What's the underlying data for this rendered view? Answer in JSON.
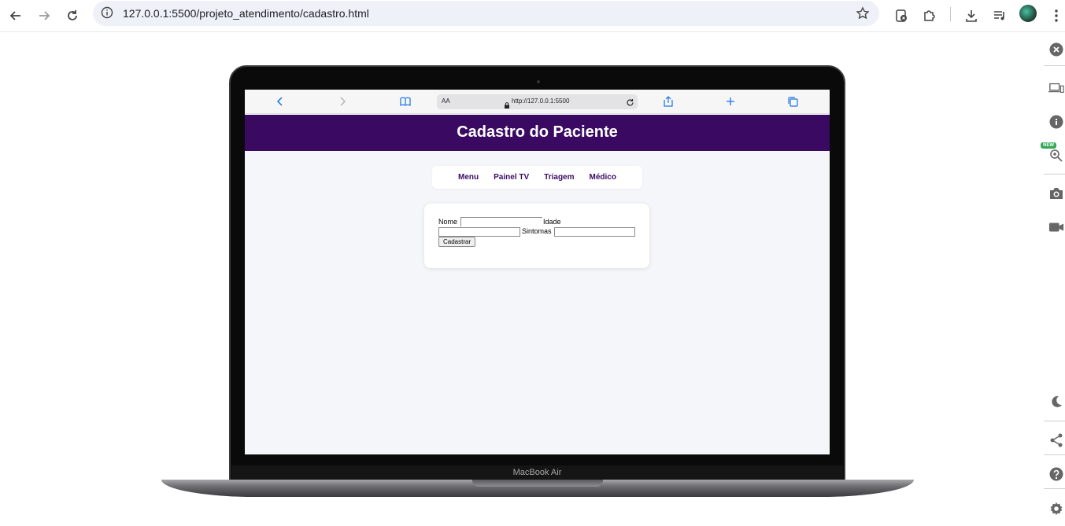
{
  "browser": {
    "url": "127.0.0.1:5500/projeto_atendimento/cadastro.html",
    "icons": [
      "back-icon",
      "forward-icon",
      "reload-icon",
      "site-info-icon",
      "bookmark-star-icon",
      "extension-icon",
      "puzzle-icon",
      "download-icon",
      "media-icon",
      "profile-avatar",
      "more-menu-icon"
    ]
  },
  "side_panel": {
    "new_badge": "NEW",
    "icons": [
      "close-icon",
      "devices-icon",
      "info-icon",
      "zoom-icon",
      "camera-icon",
      "video-icon",
      "dark-mode-icon",
      "share-icon",
      "help-icon",
      "settings-icon"
    ]
  },
  "device": {
    "label": "MacBook Air"
  },
  "safari": {
    "aa": "AA",
    "url": "http://127.0.0.1:5500"
  },
  "page": {
    "title": "Cadastro do Paciente",
    "header_color": "#3a0a63",
    "nav": [
      "Menu",
      "Painel TV",
      "Triagem",
      "Médico"
    ],
    "form": {
      "nome_label": "Nome",
      "idade_label": "Idade",
      "sintomas_label": "Sintomas",
      "nome_value": "",
      "idade_value": "",
      "sintomas_value": "",
      "submit_label": "Cadastrar"
    }
  }
}
